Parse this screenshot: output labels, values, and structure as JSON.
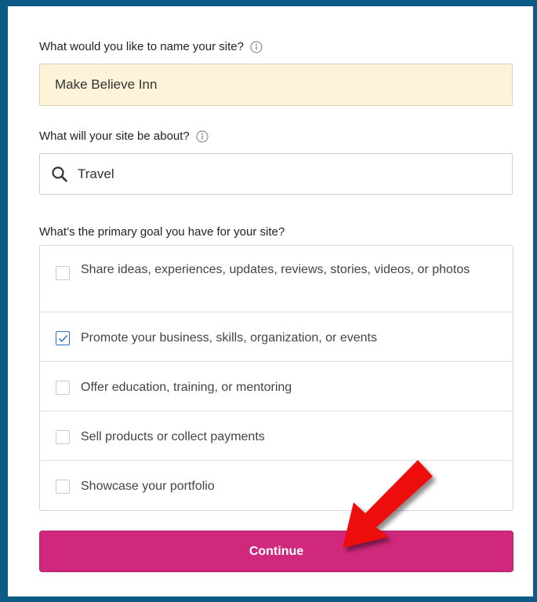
{
  "form": {
    "site_name": {
      "label": "What would you like to name your site?",
      "value": "Make Believe Inn"
    },
    "site_topic": {
      "label": "What will your site be about?",
      "value": "Travel"
    },
    "primary_goal": {
      "label": "What’s the primary goal you have for your site?",
      "options": [
        {
          "label": "Share ideas, experiences, updates, reviews, stories, videos, or photos",
          "checked": false
        },
        {
          "label": "Promote your business, skills, organization, or events",
          "checked": true
        },
        {
          "label": "Offer education, training, or mentoring",
          "checked": false
        },
        {
          "label": "Sell products or collect payments",
          "checked": false
        },
        {
          "label": "Showcase your portfolio",
          "checked": false
        }
      ]
    },
    "continue_label": "Continue"
  },
  "icons": {
    "info": "info-icon",
    "search": "search-icon",
    "checkmark": "checkmark-icon",
    "annotation": "red-arrow-icon"
  },
  "colors": {
    "frame": "#0c5a86",
    "name_field_bg": "#fdf3d9",
    "continue_bg": "#d0287c",
    "checkbox_checked": "#2d6fc5",
    "arrow": "#ee1111"
  }
}
